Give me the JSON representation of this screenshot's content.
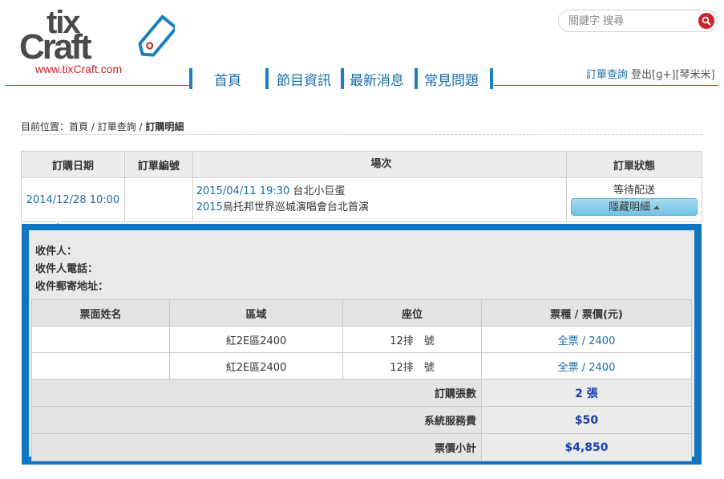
{
  "header": {
    "logo_top": "tix",
    "logo_main": "Craft",
    "logo_url": "www.tixCraft.com",
    "search_placeholder": "關鍵字 搜尋",
    "nav": [
      "首頁",
      "節目資訊",
      "最新消息",
      "常見問題"
    ],
    "account": {
      "order_query": "訂單查詢",
      "logout": "登出[g+][琴米米]"
    }
  },
  "breadcrumb": {
    "prefix": "目前位置：",
    "items": [
      "首頁",
      "訂單查詢"
    ],
    "current": "訂購明細"
  },
  "order_table": {
    "headers": [
      "訂購日期",
      "訂單編號",
      "場次",
      "訂單狀態"
    ],
    "row": {
      "date": "2014/12/28 10:00",
      "order_no": "",
      "show_datetime": "2015/04/11 19:30",
      "venue": "台北小巨蛋",
      "show_year": "2015",
      "show_name": "烏托邦世界巡城演唱會台北首演",
      "status": "等待配送",
      "toggle_label": "隱藏明細"
    }
  },
  "recipient": {
    "name_label": "收件人：",
    "phone_label": "收件人電話：",
    "address_label": "收件郵寄地址："
  },
  "tickets": {
    "headers": [
      "票面姓名",
      "區域",
      "座位",
      "票種 / 票價(元)"
    ],
    "rows": [
      {
        "name": "",
        "area": "紅2E區2400",
        "seat": "12排　號",
        "type_price": "全票 / 2400"
      },
      {
        "name": "",
        "area": "紅2E區2400",
        "seat": "12排　號",
        "type_price": "全票 / 2400"
      }
    ],
    "summary": {
      "count_label": "訂購張數",
      "count_value": "2 張",
      "fee_label": "系統服務費",
      "fee_value": "$50",
      "subtotal_label": "票價小計",
      "subtotal_value": "$4,850"
    }
  },
  "colors": {
    "brand_blue": "#1076c2",
    "link_blue": "#1a6fa8",
    "logo_red": "#c8242b"
  }
}
